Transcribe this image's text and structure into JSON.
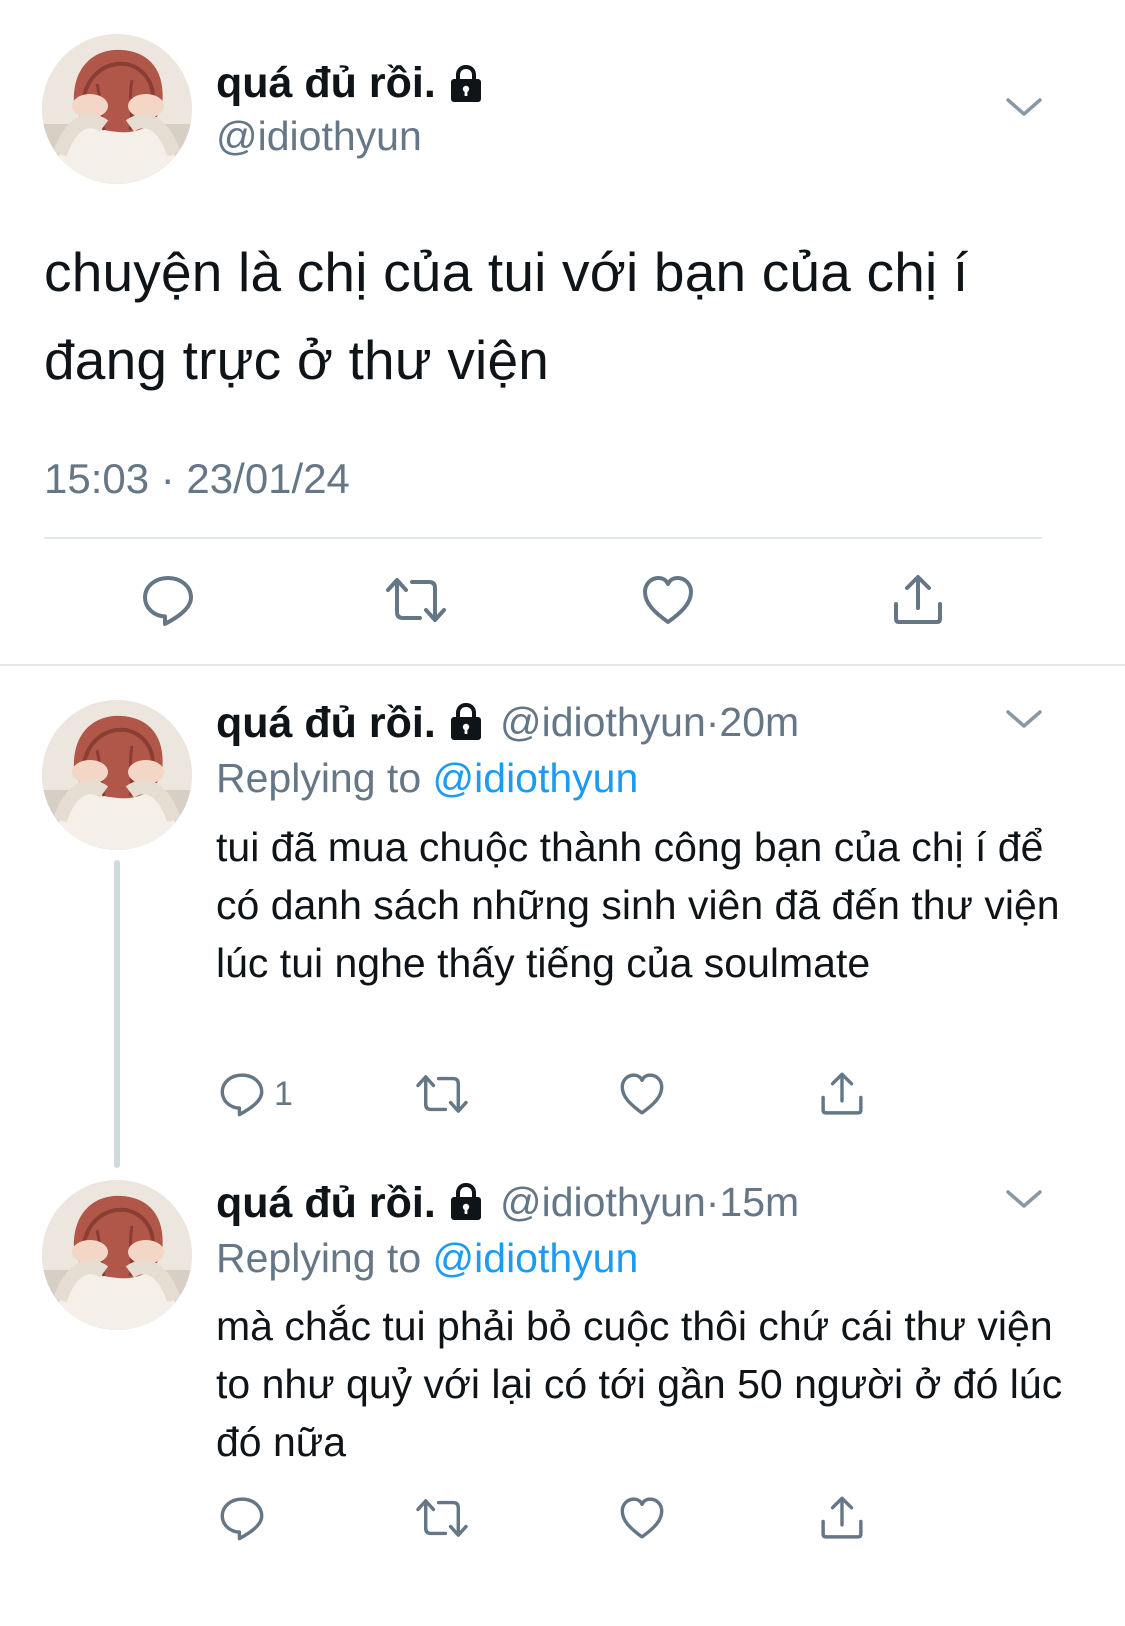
{
  "main_tweet": {
    "display_name": "quá đủ rồi.",
    "handle": "@idiothyun",
    "text": "chuyện là chị của tui với bạn của chị í đang trực ở thư viện",
    "timestamp": "15:03 · 23/01/24",
    "icons": [
      "lock-icon",
      "chevron-down-icon",
      "reply-icon",
      "retweet-icon",
      "like-icon",
      "share-icon"
    ]
  },
  "replies": [
    {
      "display_name": "quá đủ rồi.",
      "handle": "@idiothyun",
      "separator": "·",
      "time": "20m",
      "replying_prefix": "Replying to",
      "replying_handle": "@idiothyun",
      "text": "tui đã mua chuộc thành công bạn của chị í để có danh sách những sinh viên đã đến thư viện lúc tui nghe thấy tiếng của soulmate",
      "reply_count": "1"
    },
    {
      "display_name": "quá đủ rồi.",
      "handle": "@idiothyun",
      "separator": "·",
      "time": "15m",
      "replying_prefix": "Replying to",
      "replying_handle": "@idiothyun",
      "text": "mà chắc tui phải bỏ cuộc thôi chứ cái thư viện to như quỷ với lại có tới gần 50 người ở đó lúc đó nữa",
      "reply_count": ""
    }
  ],
  "colors": {
    "text": "#0f1419",
    "secondary": "#657786",
    "link": "#1d9bf0",
    "divider": "#e1e8ed"
  }
}
